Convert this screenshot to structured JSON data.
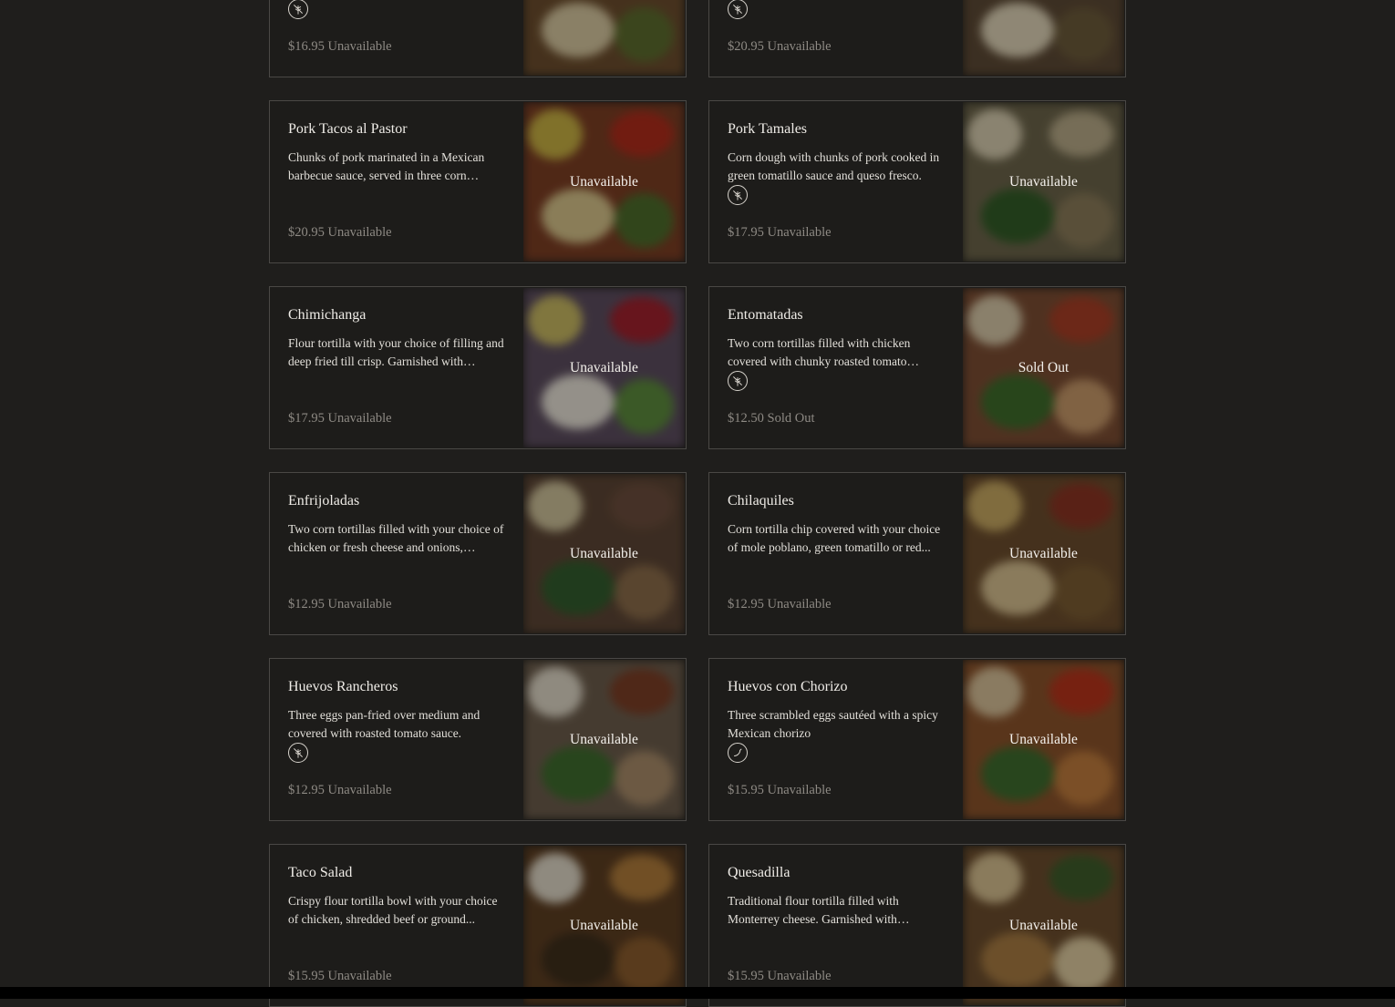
{
  "menu_items": [
    {
      "name": "",
      "description": "",
      "diet_icon": "leaf-icon",
      "price": "$16.95",
      "status": "Unavailable",
      "photo": {
        "base": "#6a4a2a",
        "spots": [
          "#c4a070",
          "#8a3a22",
          "#d8c8a0",
          "#5a6a2a"
        ]
      }
    },
    {
      "name": "",
      "description": "",
      "diet_icon": "leaf-icon",
      "price": "$20.95",
      "status": "Unavailable",
      "photo": {
        "base": "#5a4632",
        "spots": [
          "#c8b08a",
          "#7a4a2a",
          "#e0d4b8",
          "#6a5838"
        ]
      }
    },
    {
      "name": "Pork Tacos al Pastor",
      "description": "Chunks of pork marinated in a Mexican barbecue sauce, served in three corn tortilla...",
      "diet_icon": "",
      "price": "$20.95",
      "status": "Unavailable",
      "photo": {
        "base": "#7a3a20",
        "spots": [
          "#c8b040",
          "#b02818",
          "#d8c48a",
          "#4a6a28"
        ]
      }
    },
    {
      "name": "Pork Tamales",
      "description": "Corn dough with chunks of pork cooked in green tomatillo sauce and queso fresco.",
      "diet_icon": "leaf-icon",
      "price": "$17.95",
      "status": "Unavailable",
      "photo": {
        "base": "#6a6248",
        "spots": [
          "#d8cdb0",
          "#b8aa88",
          "#2e5a24",
          "#8a7a58"
        ]
      }
    },
    {
      "name": "Chimichanga",
      "description": "Flour tortilla with your choice of filling and deep fried till crisp. Garnished with lettuce...",
      "diet_icon": "",
      "price": "$17.95",
      "status": "Unavailable",
      "photo": {
        "base": "#5a4a5e",
        "spots": [
          "#c8b860",
          "#a01c2a",
          "#e8e2d8",
          "#5a8a3a"
        ]
      }
    },
    {
      "name": "Entomatadas",
      "description": "Two corn tortillas filled with chicken covered with chunky roasted tomato sauce...",
      "diet_icon": "leaf-icon",
      "price": "$12.50",
      "status": "Sold Out",
      "photo": {
        "base": "#7a4a30",
        "spots": [
          "#d8c8a8",
          "#a83a22",
          "#3a6a28",
          "#c89868"
        ]
      }
    },
    {
      "name": "Enfrijoladas",
      "description": "Two corn tortillas filled with your choice of chicken or fresh cheese and onions, covere...",
      "diet_icon": "",
      "price": "$12.95",
      "status": "Unavailable",
      "photo": {
        "base": "#5a4232",
        "spots": [
          "#cfc29a",
          "#6a4a3a",
          "#2e5a2a",
          "#8a6a48"
        ]
      }
    },
    {
      "name": "Chilaquiles",
      "description": "Corn tortilla chip covered with your choice of mole poblano, green tomatillo or red...",
      "diet_icon": "",
      "price": "$12.95",
      "status": "Unavailable",
      "photo": {
        "base": "#6a4a2a",
        "spots": [
          "#c8a860",
          "#8a3020",
          "#d8c090",
          "#7a5a30"
        ]
      }
    },
    {
      "name": "Huevos Rancheros",
      "description": "Three eggs pan-fried over medium and covered with roasted tomato sauce.",
      "diet_icon": "leaf-icon",
      "price": "$12.95",
      "status": "Unavailable",
      "photo": {
        "base": "#6a5a4a",
        "spots": [
          "#e0d8c8",
          "#7a3a22",
          "#3a6a2a",
          "#a88a68"
        ]
      }
    },
    {
      "name": "Huevos con Chorizo",
      "description": "Three scrambled eggs sautéed with a spicy Mexican chorizo",
      "diet_icon": "pepper-icon",
      "price": "$15.95",
      "status": "Unavailable",
      "photo": {
        "base": "#8a5028",
        "spots": [
          "#d8c098",
          "#b83018",
          "#3a6a2a",
          "#c07a3a"
        ]
      }
    },
    {
      "name": "Taco Salad",
      "description": "Crispy flour tortilla bowl with your choice of chicken, shredded beef or ground...",
      "diet_icon": "",
      "price": "$15.95",
      "status": "Unavailable",
      "photo": {
        "base": "#5a3a1e",
        "spots": [
          "#e0d8c8",
          "#b07a38",
          "#3a2a18",
          "#8a5a2a"
        ]
      }
    },
    {
      "name": "Quesadilla",
      "description": "Traditional flour tortilla filled with Monterrey cheese. Garnished with lettuce,...",
      "diet_icon": "",
      "price": "$15.95",
      "status": "Unavailable",
      "photo": {
        "base": "#6a4a2a",
        "spots": [
          "#d8c090",
          "#3a5a28",
          "#a87a40",
          "#e0cca0"
        ]
      }
    }
  ]
}
